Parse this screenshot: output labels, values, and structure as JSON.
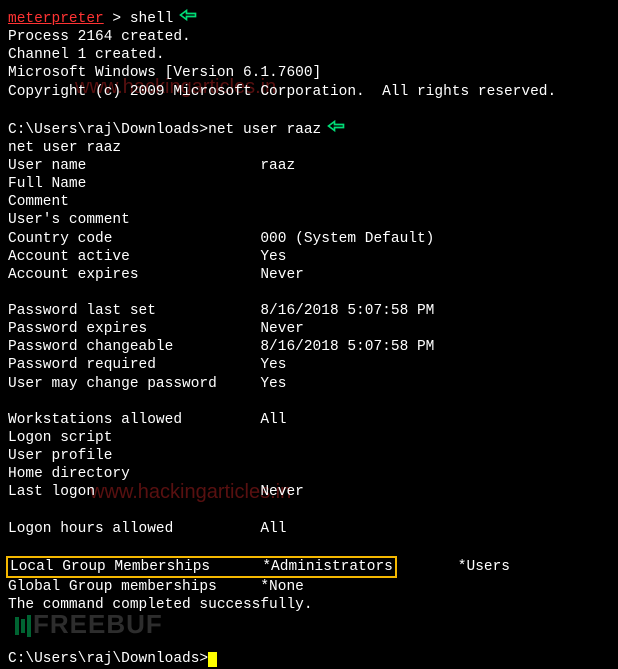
{
  "prompt1": {
    "context": "meterpreter",
    "gt": " > ",
    "cmd": "shell"
  },
  "process_line": "Process 2164 created.",
  "channel_line": "Channel 1 created.",
  "version_line": "Microsoft Windows [Version 6.1.7600]",
  "copyright_line": "Copyright (c) 2009 Microsoft Corporation.  All rights reserved.",
  "blank": " ",
  "prompt2": {
    "path": "C:\\Users\\raj\\Downloads>",
    "cmd": "net user raaz"
  },
  "echo_cmd": "net user raaz",
  "fields": {
    "username_label": "User name                    ",
    "username_value": "raaz",
    "fullname": "Full Name",
    "comment": "Comment",
    "usercomment": "User's comment",
    "country_label": "Country code                 ",
    "country_value": "000 (System Default)",
    "active_label": "Account active               ",
    "active_value": "Yes",
    "expires_label": "Account expires              ",
    "expires_value": "Never",
    "pwset_label": "Password last set            ",
    "pwset_value": "8/16/2018 5:07:58 PM",
    "pwexp_label": "Password expires             ",
    "pwexp_value": "Never",
    "pwchg_label": "Password changeable          ",
    "pwchg_value": "8/16/2018 5:07:58 PM",
    "pwreq_label": "Password required            ",
    "pwreq_value": "Yes",
    "pwmay_label": "User may change password     ",
    "pwmay_value": "Yes",
    "wks_label": "Workstations allowed         ",
    "wks_value": "All",
    "logon_script": "Logon script",
    "user_profile": "User profile",
    "home_dir": "Home directory",
    "last_label": "Last logon                   ",
    "last_value": "Never",
    "hours_label": "Logon hours allowed          ",
    "hours_value": "All",
    "local_label": "Local Group Memberships      ",
    "local_value": "*Administrators",
    "local_extra": "       *Users",
    "global_label": "Global Group memberships     ",
    "global_value": "*None",
    "success": "The command completed successfully."
  },
  "prompt3": "C:\\Users\\raj\\Downloads>",
  "watermarks": {
    "w1": "www.hackingarticles.in",
    "w2": "www.hackingarticles.in",
    "w3": "FREEBUF"
  }
}
